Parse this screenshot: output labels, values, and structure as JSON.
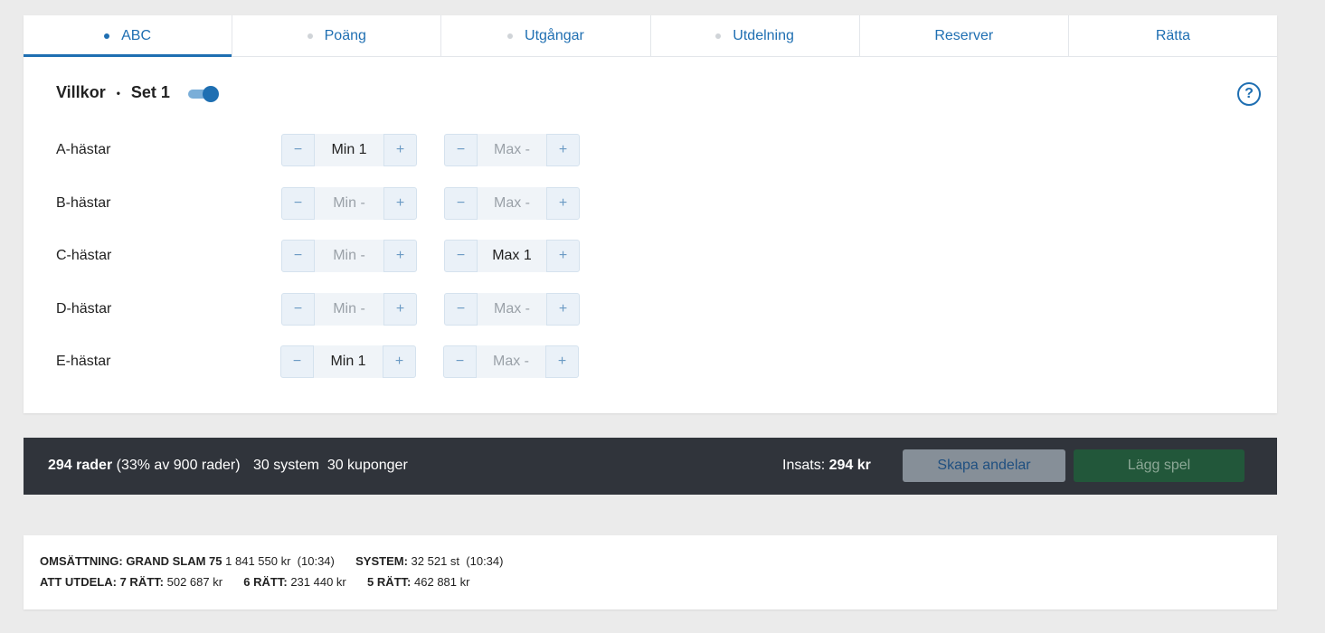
{
  "tabs": [
    {
      "label": "ABC",
      "dot": true,
      "active": true
    },
    {
      "label": "Poäng",
      "dot": true
    },
    {
      "label": "Utgångar",
      "dot": true
    },
    {
      "label": "Utdelning",
      "dot": true
    },
    {
      "label": "Reserver",
      "dot": false
    },
    {
      "label": "Rätta",
      "dot": false
    }
  ],
  "conditions": {
    "title": "Villkor",
    "bullet": "•",
    "set_label": "Set 1",
    "toggle_on": true,
    "help_label": "?"
  },
  "rows": [
    {
      "label": "A-hästar",
      "min": "Min 1",
      "max": "Max -"
    },
    {
      "label": "B-hästar",
      "min": "Min -",
      "max": "Max -"
    },
    {
      "label": "C-hästar",
      "min": "Min -",
      "max": "Max 1"
    },
    {
      "label": "D-hästar",
      "min": "Min -",
      "max": "Max -"
    },
    {
      "label": "E-hästar",
      "min": "Min 1",
      "max": "Max -"
    }
  ],
  "stepper": {
    "minus": "−",
    "plus": "+"
  },
  "summary": {
    "rows_bold": "294 rader",
    "rows_rest": "(33% av 900 rader)",
    "systems": "30 system",
    "coupons": "30 kuponger",
    "stake_label": "Insats:",
    "stake_value": "294 kr",
    "create_shares_button": "Skapa andelar",
    "place_bet_button": "Lägg spel"
  },
  "info": {
    "turnover_label": "OMSÄTTNING:",
    "game_name": "GRAND SLAM 75",
    "turnover_value": "1 841 550 kr",
    "turnover_time": "(10:34)",
    "system_label": "SYSTEM:",
    "system_value": "32 521 st",
    "system_time": "(10:34)",
    "payout_label": "ATT UTDELA:",
    "r7_label": "7 RÄTT:",
    "r7_value": "502 687 kr",
    "r6_label": "6 RÄTT:",
    "r6_value": "231 440 kr",
    "r5_label": "5 RÄTT:",
    "r5_value": "462 881 kr"
  },
  "colors": {
    "accent": "#1f6fb2",
    "summary_bar": "#30343b",
    "place_bet": "#22573a",
    "create_shares": "#868f98"
  }
}
